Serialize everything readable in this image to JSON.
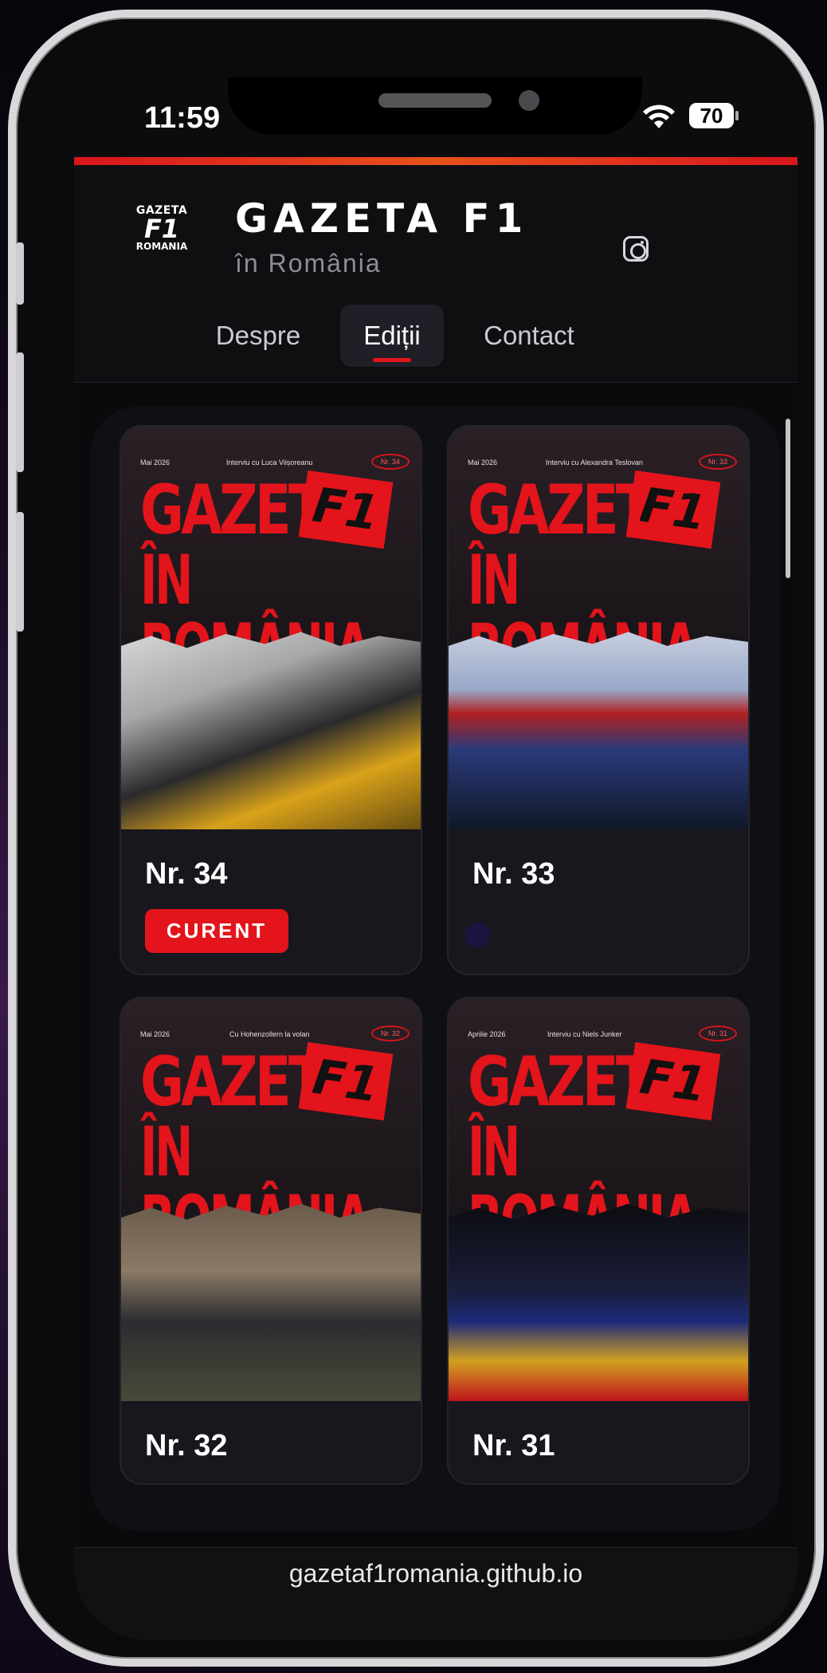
{
  "status": {
    "time": "11:59",
    "battery": "70"
  },
  "brand": {
    "logo": {
      "line1": "GAZETA",
      "line2": "F1",
      "line3": "ROMANIA"
    },
    "title": "GAZETA F1",
    "subtitle": "în România"
  },
  "nav": {
    "items": [
      {
        "label": "Despre"
      },
      {
        "label": "Ediții"
      },
      {
        "label": "Contact"
      }
    ],
    "active": "Ediții",
    "instagram_icon": "instagram-icon"
  },
  "editions": [
    {
      "title": "Nr. 34",
      "badge": "CURENT",
      "cover": {
        "date": "Mai 2026",
        "headline": "Interviu cu Luca Viișoreanu",
        "nr": "Nr. 34",
        "line1": "GAZETA",
        "line2": "ÎN ROMÂNIA",
        "f1": "F1"
      }
    },
    {
      "title": "Nr. 33",
      "cover": {
        "date": "Mai 2026",
        "headline": "Interviu cu Alexandra Teslovan",
        "nr": "Nr. 33",
        "line1": "GAZETA",
        "line2": "ÎN ROMÂNIA",
        "f1": "F1"
      }
    },
    {
      "title": "Nr. 32",
      "cover": {
        "date": "Mai 2026",
        "headline": "Cu Hohenzollern la volan",
        "nr": "Nr. 32",
        "line1": "GAZETA",
        "line2": "ÎN ROMÂNIA",
        "f1": "F1"
      }
    },
    {
      "title": "Nr. 31",
      "cover": {
        "date": "Aprilie 2026",
        "headline": "Interviu cu Niels Junker",
        "nr": "Nr. 31",
        "line1": "GAZETA",
        "line2": "ÎN ROMÂNIA",
        "f1": "F1"
      }
    }
  ],
  "url": "gazetaf1romania.github.io",
  "colors": {
    "accent": "#e3141b",
    "background": "#0c0c0f",
    "card": "#17171d"
  }
}
